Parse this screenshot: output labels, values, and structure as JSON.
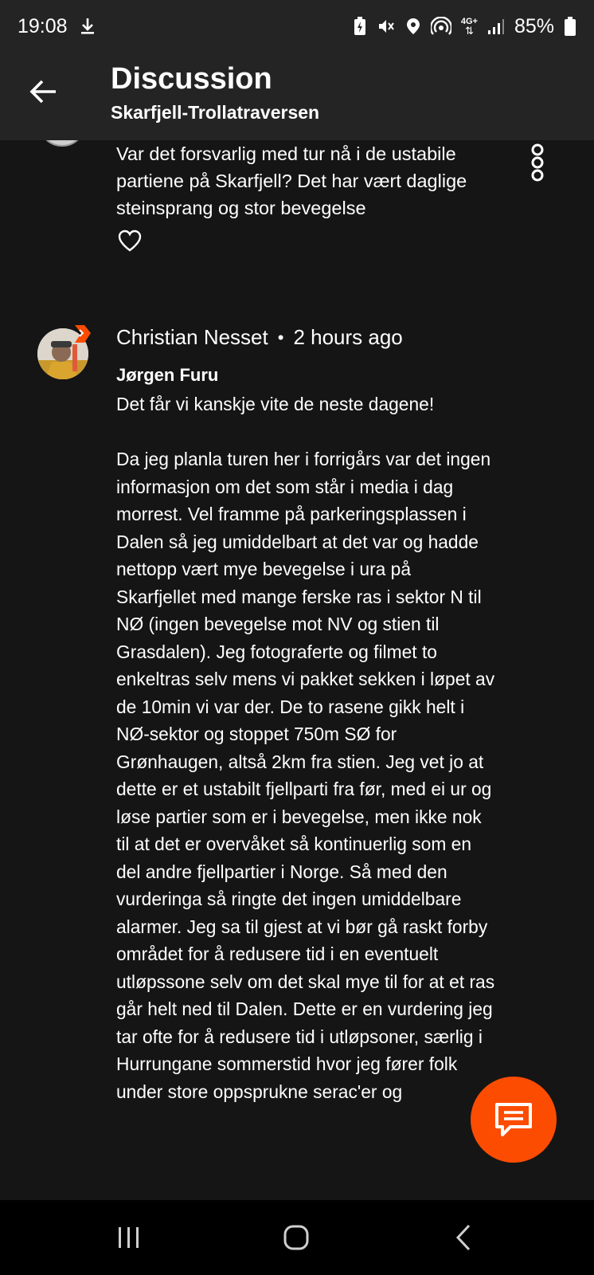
{
  "status_bar": {
    "time": "19:08",
    "icons": [
      "download-icon",
      "battery-saver-icon",
      "mute-icon",
      "location-icon",
      "hotspot-icon",
      "4g-plus-icon",
      "signal-icon",
      "battery-icon"
    ],
    "network": "4G+",
    "battery": "85%"
  },
  "header": {
    "title": "Discussion",
    "subtitle": "Skarfjell-Trollatraversen"
  },
  "previous_comment": {
    "text": "Var det forsvarlig med tur nå i de ustabile partiene på Skarfjell? Det har vært daglige steinsprang og stor bevegelse"
  },
  "comment": {
    "author": "Christian Nesset",
    "separator": "•",
    "time": "2 hours ago",
    "reply_to": "Jørgen Furu",
    "body": "Det får vi kanskje vite de neste dagene!\n\nDa jeg planla turen her i forrigårs var det ingen informasjon om det som står i media i dag morrest. Vel framme på parkeringsplassen i Dalen så jeg umiddelbart at det var og hadde nettopp vært mye bevegelse i ura på Skarfjellet med mange ferske ras i sektor N til NØ (ingen bevegelse mot NV og stien til Grasdalen). Jeg fotograferte og filmet to enkeltras selv mens vi pakket sekken i løpet av de 10min vi var der. De to rasene gikk helt i NØ-sektor og stoppet 750m SØ for Grønhaugen, altså 2km fra stien. Jeg vet jo at dette er et ustabilt fjellparti fra før, med ei ur og løse partier som er i bevegelse, men ikke nok til at det er overvåket så kontinuerlig som en del andre fjellpartier i Norge. Så med den vurderinga så ringte det ingen umiddelbare alarmer. Jeg sa til gjest at vi bør gå raskt forby området for å redusere tid i en eventuelt utløpssone selv om det skal mye til for at et ras går helt ned til Dalen. Dette er en vurdering jeg tar ofte for å redusere tid i utløpsoner, særlig i Hurrungane sommerstid hvor jeg fører folk under store oppsprukne serac'er og"
  },
  "colors": {
    "background": "#151515",
    "header": "#242424",
    "accent": "#fc4c02",
    "nav": "#000000"
  }
}
